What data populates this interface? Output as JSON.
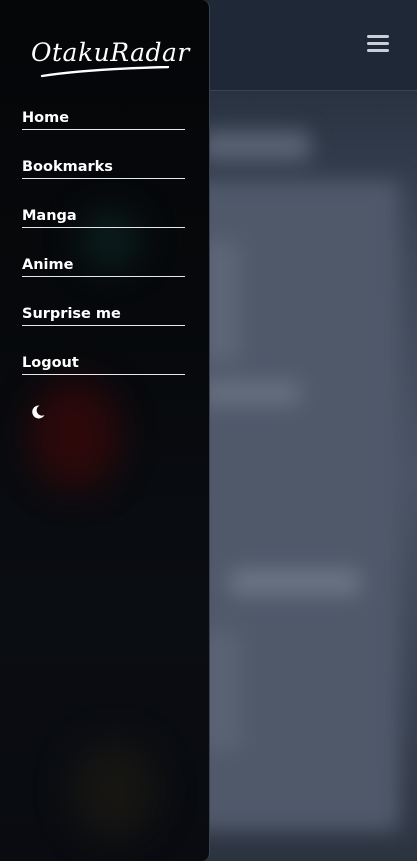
{
  "app": {
    "brand": "OtakuRadar"
  },
  "header": {
    "menu_icon": "hamburger-menu-icon"
  },
  "drawer": {
    "items": [
      {
        "label": "Home"
      },
      {
        "label": "Bookmarks"
      },
      {
        "label": "Manga"
      },
      {
        "label": "Anime"
      },
      {
        "label": "Surprise me"
      },
      {
        "label": "Logout"
      }
    ],
    "theme_toggle_icon": "moon-icon"
  },
  "colors": {
    "drawer_bg": "#050608",
    "topbar_bg": "#1f2836",
    "text": "#ffffff",
    "accent_glow_red": "#5a0f0f",
    "accent_glow_teal": "#0f3a35"
  }
}
